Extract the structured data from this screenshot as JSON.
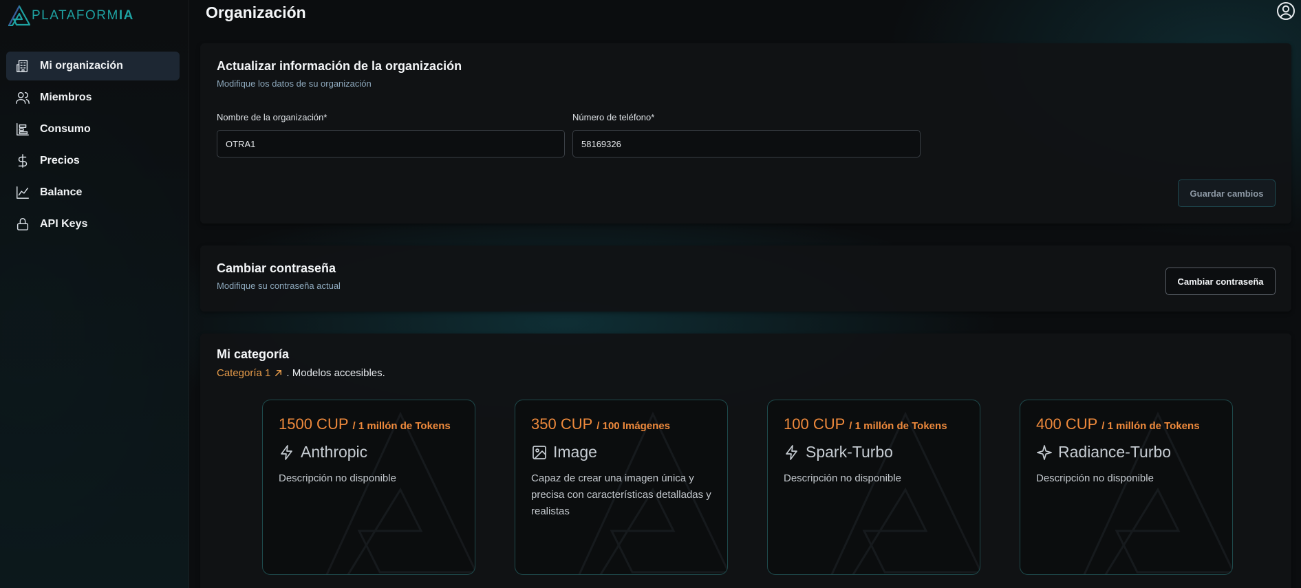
{
  "brand": {
    "name_part1": "PLATAFORM",
    "name_part2": "IA"
  },
  "sidebar": {
    "items": [
      {
        "label": "Mi organización",
        "icon": "building-icon",
        "active": true
      },
      {
        "label": "Miembros",
        "icon": "users-icon",
        "active": false
      },
      {
        "label": "Consumo",
        "icon": "consumption-icon",
        "active": false
      },
      {
        "label": "Precios",
        "icon": "dollar-icon",
        "active": false
      },
      {
        "label": "Balance",
        "icon": "chart-line-icon",
        "active": false
      },
      {
        "label": "API Keys",
        "icon": "lock-icon",
        "active": false
      }
    ]
  },
  "header": {
    "title": "Organización"
  },
  "org_form": {
    "title": "Actualizar información de la organización",
    "subtitle": "Modifique los datos de su organización",
    "name_label": "Nombre de la organización",
    "name_value": "OTRA1",
    "phone_label": "Número de teléfono",
    "phone_value": "58169326",
    "required_mark": "*",
    "save_label": "Guardar cambios"
  },
  "password": {
    "title": "Cambiar contraseña",
    "subtitle": "Modifique su contraseña actual",
    "button_label": "Cambiar contraseña"
  },
  "category": {
    "title": "Mi categoría",
    "link_label": "Categoría 1",
    "suffix": ". Modelos accesibles.",
    "models": [
      {
        "price": "1500 CUP",
        "unit": "/ 1 millón de Tokens",
        "name": "Anthropic",
        "icon": "lightning-icon",
        "description": "Descripción no disponible"
      },
      {
        "price": "350 CUP",
        "unit": "/ 100 Imágenes",
        "name": "Image",
        "icon": "image-icon",
        "description": "Capaz de crear una imagen única y precisa con características detalladas y realistas"
      },
      {
        "price": "100 CUP",
        "unit": "/ 1 millón de Tokens",
        "name": "Spark-Turbo",
        "icon": "lightning-icon",
        "description": "Descripción no disponible"
      },
      {
        "price": "400 CUP",
        "unit": "/ 1 millón de Tokens",
        "name": "Radiance-Turbo",
        "icon": "sparkle-icon",
        "description": "Descripción no disponible"
      }
    ]
  },
  "colors": {
    "accent_orange": "#ef8a3c",
    "brand_teal": "#1ea3a3",
    "active_nav": "#1d2733"
  }
}
